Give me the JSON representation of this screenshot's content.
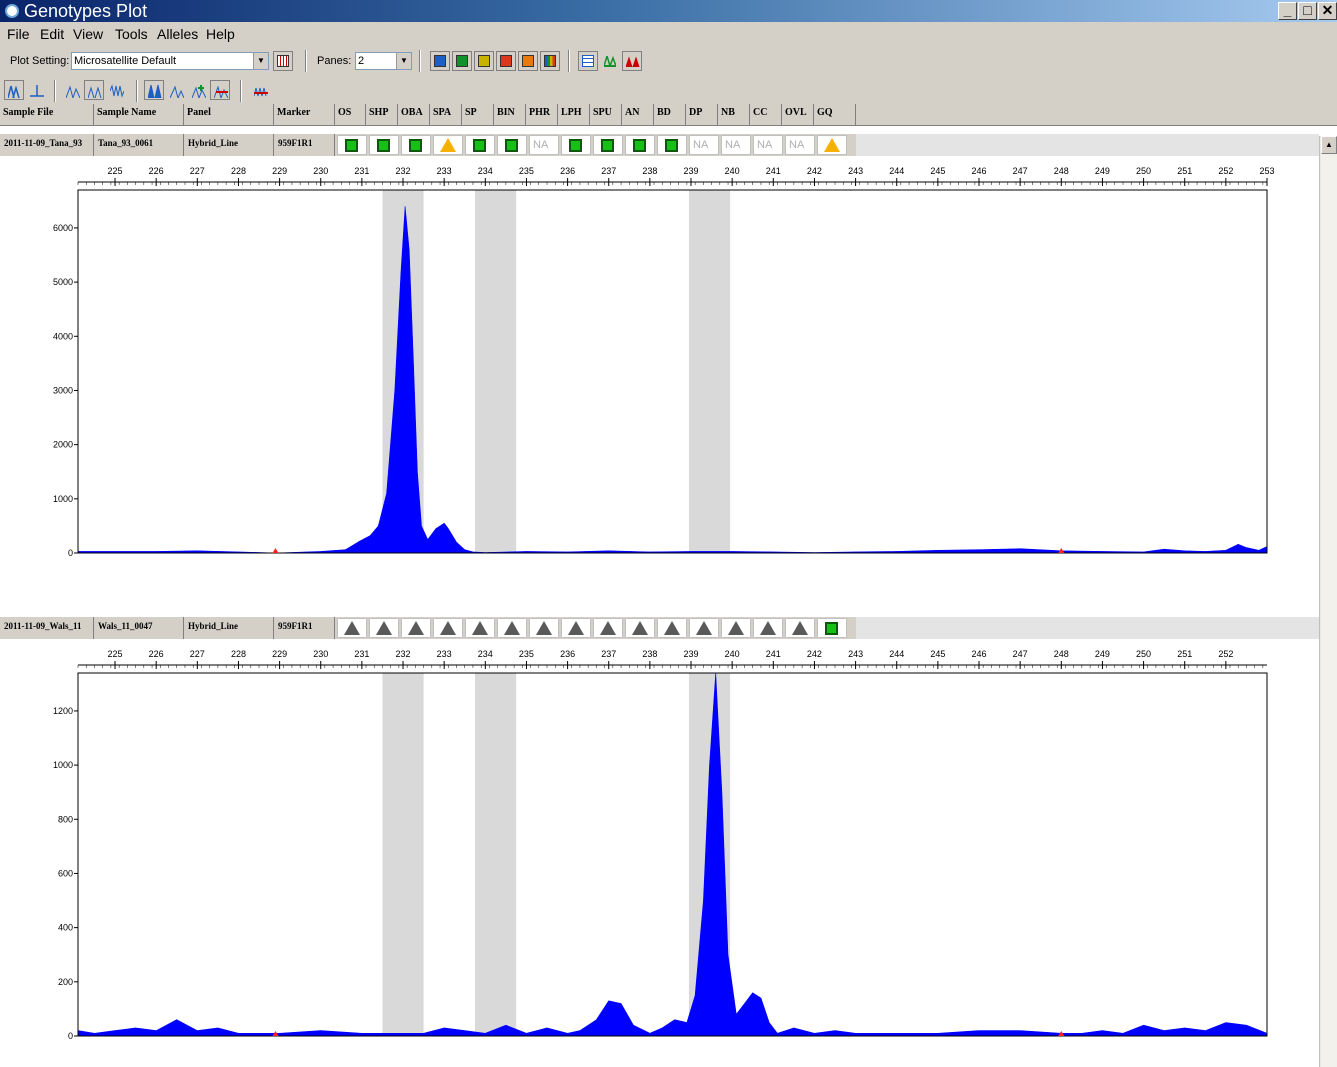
{
  "window": {
    "title": "Genotypes Plot"
  },
  "menu": [
    "File",
    "Edit",
    "View",
    "Tools",
    "Alleles",
    "Help"
  ],
  "toolbar": {
    "plot_setting_label": "Plot Setting:",
    "plot_setting_value": "Microsatellite Default",
    "panes_label": "Panes:",
    "panes_value": "2",
    "color_buttons": [
      "#1c5fc4",
      "#14902a",
      "#c8b400",
      "#d83a1a",
      "#e87a10",
      "#multi"
    ]
  },
  "columns": [
    "Sample File",
    "Sample Name",
    "Panel",
    "Marker",
    "OS",
    "SHP",
    "OBA",
    "SPA",
    "SP",
    "BIN",
    "PHR",
    "LPH",
    "SPU",
    "AN",
    "BD",
    "DP",
    "NB",
    "CC",
    "OVL",
    "GQ"
  ],
  "rows": [
    {
      "sample_file": "2011-11-09_Tana_93",
      "sample_name": "Tana_93_0061",
      "panel": "Hybrid_Line",
      "marker": "959F1R1",
      "flags": [
        "ok",
        "ok",
        "ok",
        "warn",
        "ok",
        "ok",
        "NA",
        "ok",
        "ok",
        "ok",
        "ok",
        "NA",
        "NA",
        "NA",
        "NA",
        "warn"
      ]
    },
    {
      "sample_file": "2011-11-09_Wals_11",
      "sample_name": "Wals_11_0047",
      "panel": "Hybrid_Line",
      "marker": "959F1R1",
      "flags": [
        "grey",
        "grey",
        "grey",
        "grey",
        "grey",
        "grey",
        "grey",
        "grey",
        "grey",
        "grey",
        "grey",
        "grey",
        "grey",
        "grey",
        "grey",
        "ok"
      ]
    }
  ],
  "chart_data": [
    {
      "type": "area",
      "x_ticks": [
        225,
        226,
        227,
        228,
        229,
        230,
        231,
        232,
        233,
        234,
        235,
        236,
        237,
        238,
        239,
        240,
        241,
        242,
        243,
        244,
        245,
        246,
        247,
        248,
        249,
        250,
        251,
        252,
        253
      ],
      "xlim": [
        224.1,
        253
      ],
      "ylim": [
        0,
        6700
      ],
      "y_ticks": [
        0,
        1000,
        2000,
        3000,
        4000,
        5000,
        6000
      ],
      "bins": [
        [
          231.5,
          232.5
        ],
        [
          233.75,
          234.75
        ],
        [
          238.95,
          239.95
        ]
      ],
      "series": [
        {
          "color": "#0000ff",
          "x": [
            224.1,
            226,
            227,
            228,
            228.9,
            230,
            230.6,
            230.9,
            231.2,
            231.4,
            231.6,
            231.8,
            231.95,
            232.05,
            232.15,
            232.25,
            232.35,
            232.45,
            232.6,
            232.8,
            233,
            233.1,
            233.3,
            233.5,
            233.7,
            234,
            235,
            236,
            237,
            238,
            239,
            240,
            241,
            242,
            243,
            244,
            245,
            246,
            247,
            248,
            249,
            250,
            250.5,
            251,
            251.5,
            252,
            252.3,
            252.5,
            252.8,
            253
          ],
          "y": [
            30,
            30,
            40,
            20,
            0,
            30,
            60,
            200,
            320,
            500,
            1100,
            3000,
            5200,
            6400,
            5600,
            3600,
            1500,
            500,
            250,
            450,
            550,
            450,
            200,
            60,
            20,
            10,
            30,
            20,
            40,
            20,
            30,
            30,
            20,
            10,
            20,
            30,
            50,
            60,
            80,
            40,
            30,
            20,
            70,
            40,
            30,
            50,
            160,
            100,
            50,
            120
          ]
        }
      ]
    },
    {
      "type": "area",
      "x_ticks": [
        225,
        226,
        227,
        228,
        229,
        230,
        231,
        232,
        233,
        234,
        235,
        236,
        237,
        238,
        239,
        240,
        241,
        242,
        243,
        244,
        245,
        246,
        247,
        248,
        249,
        250,
        251,
        252
      ],
      "xlim": [
        224.1,
        253
      ],
      "ylim": [
        0,
        1340
      ],
      "y_ticks": [
        0,
        200,
        400,
        600,
        800,
        1000,
        1200
      ],
      "bins": [
        [
          231.5,
          232.5
        ],
        [
          233.75,
          234.75
        ],
        [
          238.95,
          239.95
        ]
      ],
      "series": [
        {
          "color": "#0000ff",
          "x": [
            224.1,
            224.5,
            225,
            225.5,
            226,
            226.5,
            227,
            227.5,
            228,
            229,
            230,
            231,
            232,
            232.5,
            233,
            233.5,
            234,
            234.5,
            235,
            235.5,
            236,
            236.3,
            236.7,
            237,
            237.3,
            237.6,
            238,
            238.3,
            238.6,
            238.9,
            239.1,
            239.3,
            239.45,
            239.6,
            239.75,
            239.9,
            240.1,
            240.3,
            240.5,
            240.7,
            240.9,
            241.1,
            241.5,
            242,
            242.5,
            243,
            244,
            245,
            246,
            247,
            248,
            248.5,
            249,
            249.5,
            250,
            250.5,
            251,
            251.5,
            252,
            252.5,
            253
          ],
          "y": [
            20,
            10,
            20,
            30,
            20,
            60,
            20,
            30,
            10,
            10,
            20,
            10,
            10,
            10,
            30,
            20,
            10,
            40,
            10,
            30,
            10,
            20,
            60,
            130,
            120,
            40,
            10,
            30,
            60,
            50,
            150,
            500,
            1000,
            1340,
            900,
            300,
            80,
            120,
            160,
            140,
            50,
            10,
            30,
            10,
            20,
            10,
            10,
            10,
            20,
            20,
            10,
            10,
            20,
            10,
            40,
            20,
            30,
            20,
            50,
            40,
            10
          ]
        }
      ]
    }
  ]
}
